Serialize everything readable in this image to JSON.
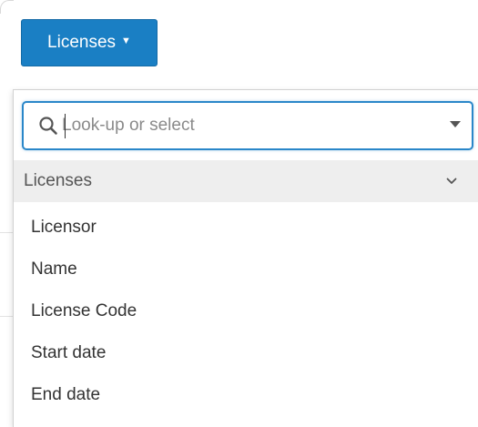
{
  "button": {
    "label": "Licenses",
    "caret": "▼"
  },
  "search": {
    "placeholder": "Look-up or select",
    "value": ""
  },
  "group": {
    "label": "Licenses"
  },
  "options": [
    {
      "label": "Licensor"
    },
    {
      "label": "Name"
    },
    {
      "label": "License Code"
    },
    {
      "label": "Start date"
    },
    {
      "label": "End date"
    }
  ],
  "colors": {
    "button_bg": "#1a7fc4",
    "focus_border": "#2a87c9",
    "group_bg": "#eeeeee"
  },
  "icons": {
    "search": "magnifier-icon",
    "select_caret": "caret-down-icon",
    "group_toggle": "chevron-down-icon"
  }
}
